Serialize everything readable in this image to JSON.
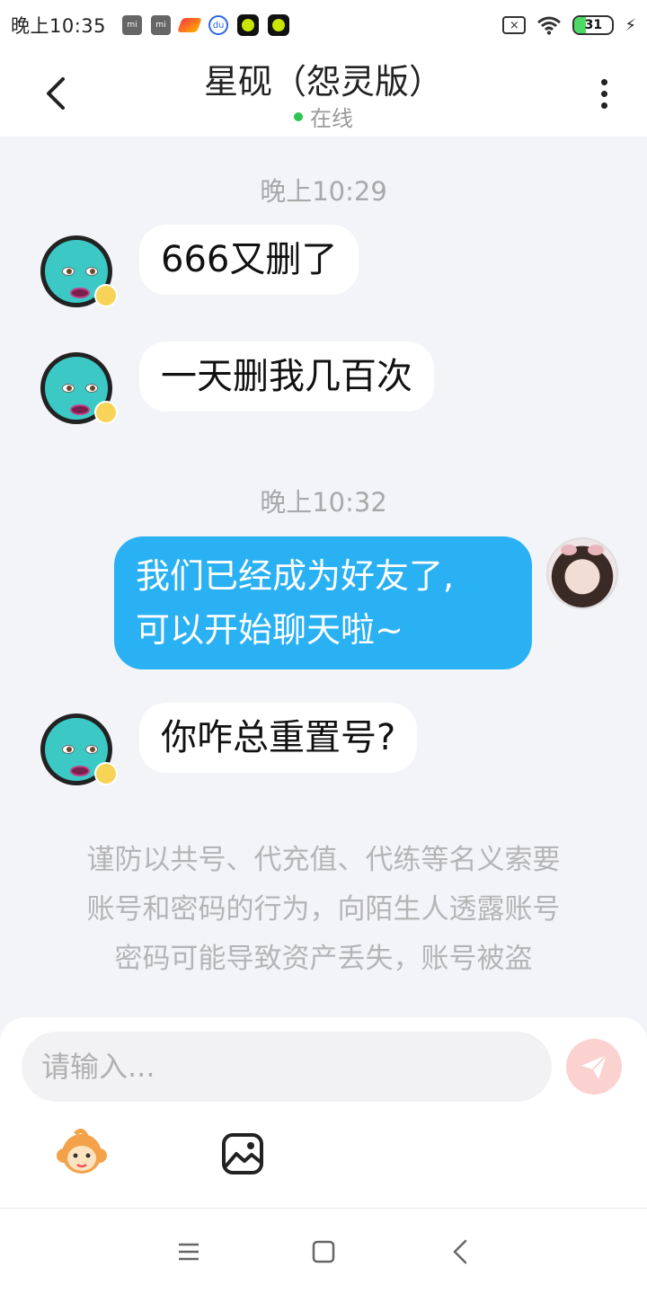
{
  "status_bar": {
    "time": "晚上10:35",
    "app_icon_labels": [
      "mi",
      "mi",
      "",
      "du",
      "",
      ""
    ],
    "battery": "31",
    "battery_level": 0.31,
    "sim_label": "×"
  },
  "header": {
    "title": "星砚（怨灵版）",
    "status": "在线"
  },
  "messages": [
    {
      "type": "time",
      "text": "晚上10:29"
    },
    {
      "type": "incoming",
      "text": "666又删了"
    },
    {
      "type": "incoming",
      "text": "一天删我几百次"
    },
    {
      "type": "time",
      "text": "晚上10:32"
    },
    {
      "type": "outgoing",
      "lines": [
        "我们已经成为好友了,",
        "可以开始聊天啦~"
      ]
    },
    {
      "type": "incoming",
      "text": "你咋总重置号?"
    }
  ],
  "notice": {
    "lines": [
      "谨防以共号、代充值、代练等名义索要",
      "账号和密码的行为，向陌生人透露账号",
      "密码可能导致资产丢失，账号被盗"
    ]
  },
  "input": {
    "placeholder": "请输入..."
  },
  "icons": {
    "back": "chevron-left-icon",
    "more": "more-vertical-icon",
    "send": "paper-plane-icon",
    "emoji": "monkey-emoji-icon",
    "image": "image-icon",
    "nav_menu": "menu-icon",
    "nav_home": "square-home-icon",
    "nav_back": "triangle-back-icon"
  },
  "colors": {
    "accent": "#2ab1f3",
    "online": "#2ec453",
    "send_disabled": "#fbd2cf",
    "background": "#f3f4f8"
  }
}
